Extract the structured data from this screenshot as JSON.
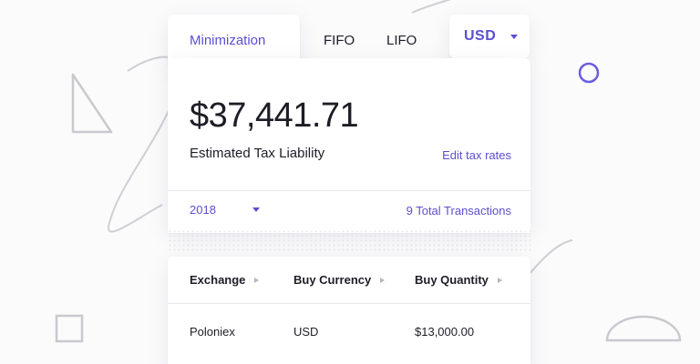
{
  "tabs": {
    "minimization": "Minimization",
    "fifo": "FIFO",
    "lifo": "LIFO",
    "active": "Minimization"
  },
  "currency": {
    "selected": "USD"
  },
  "summary": {
    "amount": "$37,441.71",
    "label": "Estimated Tax Liability",
    "edit_link": "Edit tax rates"
  },
  "filter": {
    "year": "2018",
    "transactions": "9 Total Transactions"
  },
  "table": {
    "columns": [
      "Exchange",
      "Buy Currency",
      "Buy Quantity"
    ],
    "rows": [
      [
        "Poloniex",
        "USD",
        "$13,000.00"
      ]
    ]
  },
  "colors": {
    "accent": "#5b4fcf",
    "text": "#1d1d26",
    "decor_stroke": "#c9c9cf"
  },
  "icons": [
    "caret-down-icon",
    "sort-arrow-icon",
    "triangle-decor",
    "circle-decor",
    "square-decor",
    "semicircle-decor"
  ]
}
